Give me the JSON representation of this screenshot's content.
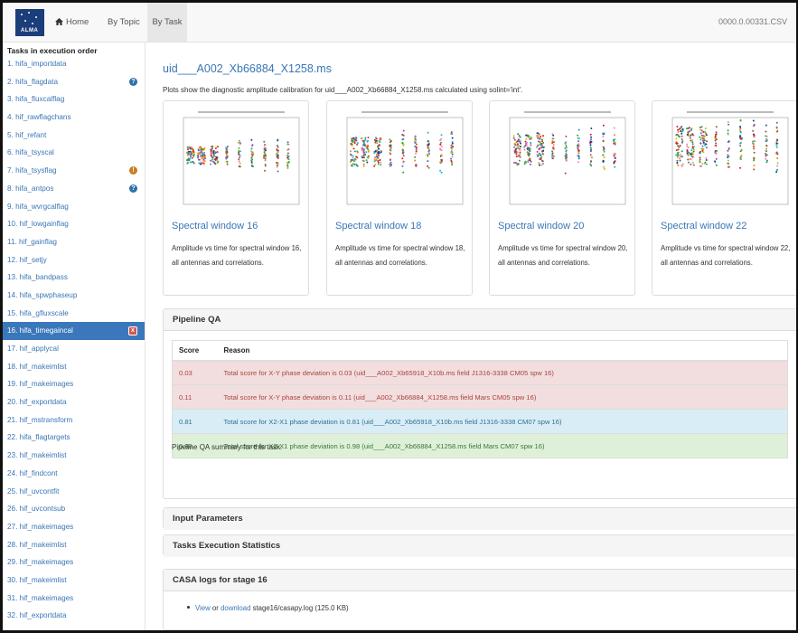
{
  "navbar": {
    "logo_text": "ALMA",
    "home_label": "Home",
    "by_topic_label": "By Topic",
    "by_task_label": "By Task",
    "right_text": "0000.0.00331.CSV"
  },
  "sidebar": {
    "heading": "Tasks in execution order",
    "items": [
      {
        "label": "1. hifa_importdata"
      },
      {
        "label": "2. hifa_flagdata",
        "badge": "?"
      },
      {
        "label": "3. hifa_fluxcalflag"
      },
      {
        "label": "4. hif_rawflagchans"
      },
      {
        "label": "5. hif_refant"
      },
      {
        "label": "6. hifa_tsyscal"
      },
      {
        "label": "7. hifa_tsysflag",
        "badge": "!"
      },
      {
        "label": "8. hifa_antpos",
        "badge": "?"
      },
      {
        "label": "9. hifa_wvrgcalflag"
      },
      {
        "label": "10. hif_lowgainflag"
      },
      {
        "label": "11. hif_gainflag"
      },
      {
        "label": "12. hif_setjy"
      },
      {
        "label": "13. hifa_bandpass"
      },
      {
        "label": "14. hifa_spwphaseup"
      },
      {
        "label": "15. hifa_gfluxscale"
      },
      {
        "label": "16. hifa_timegaincal",
        "badge": "x"
      },
      {
        "label": "17. hif_applycal"
      },
      {
        "label": "18. hif_makeimlist"
      },
      {
        "label": "19. hif_makeimages"
      },
      {
        "label": "20. hif_exportdata"
      },
      {
        "label": "21. hif_mstransform"
      },
      {
        "label": "22. hifa_flagtargets"
      },
      {
        "label": "23. hif_makeimlist"
      },
      {
        "label": "24. hif_findcont"
      },
      {
        "label": "25. hif_uvcontfit"
      },
      {
        "label": "26. hif_uvcontsub"
      },
      {
        "label": "27. hif_makeimages"
      },
      {
        "label": "28. hif_makeimlist"
      },
      {
        "label": "29. hif_makeimages"
      },
      {
        "label": "30. hif_makeimlist"
      },
      {
        "label": "31. hif_makeimages"
      },
      {
        "label": "32. hif_exportdata"
      }
    ]
  },
  "main": {
    "ms_title": "uid___A002_Xb66884_X1258.ms",
    "description": "Plots show the diagnostic amplitude calibration for uid___A002_Xb66884_X1258.ms calculated using solint='int'.",
    "thumbnails": [
      {
        "title": "Spectral window 16",
        "caption": "Amplitude vs time for spectral window 16, all antennas and correlations."
      },
      {
        "title": "Spectral window 18",
        "caption": "Amplitude vs time for spectral window 18, all antennas and correlations."
      },
      {
        "title": "Spectral window 20",
        "caption": "Amplitude vs time for spectral window 20, all antennas and correlations."
      },
      {
        "title": "Spectral window 22",
        "caption": "Amplitude vs time for spectral window 22, all antennas and correlations."
      }
    ]
  },
  "pipeline_qa": {
    "heading": "Pipeline QA",
    "col_score": "Score",
    "col_reason": "Reason",
    "rows": [
      {
        "score": "0.03",
        "reason": "Total score for X-Y phase deviation is 0.03 (uid___A002_Xb65918_X10b.ms field J1316-3338 CM05 spw 16)",
        "status": "red"
      },
      {
        "score": "0.11",
        "reason": "Total score for X-Y phase deviation is 0.11 (uid___A002_Xb66884_X1258.ms field Mars CM05 spw 16)",
        "status": "red"
      },
      {
        "score": "0.81",
        "reason": "Total score for X2-X1 phase deviation is 0.81 (uid___A002_Xb65918_X10b.ms field J1316-3338 CM07 spw 16)",
        "status": "blue"
      },
      {
        "score": "0.98",
        "reason": "Total score for X2-X1 phase deviation is 0.98 (uid___A002_Xb66884_X1258.ms field Mars CM07 spw 16)",
        "status": "green"
      }
    ],
    "summary": "Pipeline QA summary for this task."
  },
  "input_parameters": {
    "heading": "Input Parameters"
  },
  "execution_stats": {
    "heading": "Tasks Execution Statistics"
  },
  "casa_logs": {
    "heading": "CASA logs for stage 16",
    "view_label": "View",
    "or_text": " or ",
    "download_label": "download",
    "file_text": " stage16/casapy.log (125.0 KB)"
  },
  "colors": {
    "link": "#3a76b6",
    "active": "#3a78bb",
    "qa_red": "#f2dede",
    "qa_blue": "#d9edf7",
    "qa_green": "#dff0d8"
  }
}
